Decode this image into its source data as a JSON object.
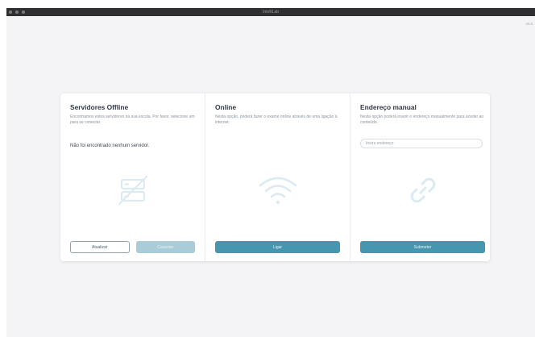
{
  "window": {
    "title": "IntelliLab",
    "version": "v0.0"
  },
  "colors": {
    "primary": "#4596ae",
    "primary_disabled": "#a9ccd8",
    "icon_light": "#dcebf1",
    "background": "#f4f4f6"
  },
  "columns": {
    "offline": {
      "title": "Servidores Offline",
      "description": "Encontramos estes servidores na sua escola. Por favor, selecione um para se conectar.",
      "status": "Não foi encontrado nenhum servidor.",
      "icon": "server-off-icon",
      "refresh_label": "Atualizar",
      "connect_label": "Conectar"
    },
    "online": {
      "title": "Online",
      "description": "Nesta opção, poderá fazer o exame online através de uma ligação à internet.",
      "icon": "wifi-icon",
      "connect_label": "Ligar"
    },
    "manual": {
      "title": "Endereço manual",
      "description": "Nesta opção poderá inserir o endereço manualmente para aceder ao conteúdo.",
      "input_placeholder": "Insira endereço",
      "input_value": "",
      "icon": "link-icon",
      "submit_label": "Submeter"
    }
  }
}
